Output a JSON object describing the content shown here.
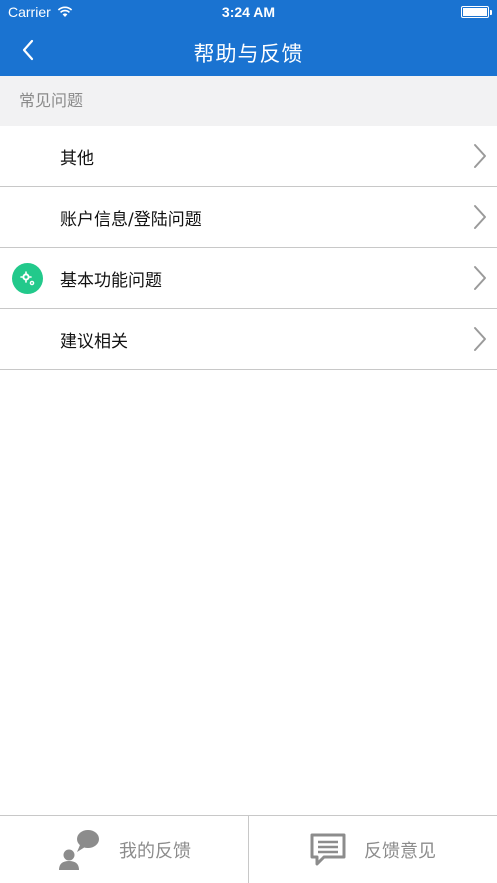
{
  "status_bar": {
    "carrier": "Carrier",
    "time": "3:24 AM"
  },
  "nav": {
    "title": "帮助与反馈",
    "back_icon": "chevron-left-icon"
  },
  "section": {
    "header": "常见问题"
  },
  "list": {
    "items": [
      {
        "label": "其他"
      },
      {
        "label": "账户信息/登陆问题"
      },
      {
        "label": "基本功能问题",
        "badge_icon": "gear-icon",
        "badge_color": "#22c98b"
      },
      {
        "label": "建议相关"
      }
    ]
  },
  "tabs": [
    {
      "label": "我的反馈",
      "icon": "user-chat-icon"
    },
    {
      "label": "反馈意见",
      "icon": "message-icon"
    }
  ],
  "colors": {
    "primary": "#1a73d1",
    "section_bg": "#f2f2f3",
    "badge": "#22c98b",
    "tab_text": "#8c8c8c"
  }
}
